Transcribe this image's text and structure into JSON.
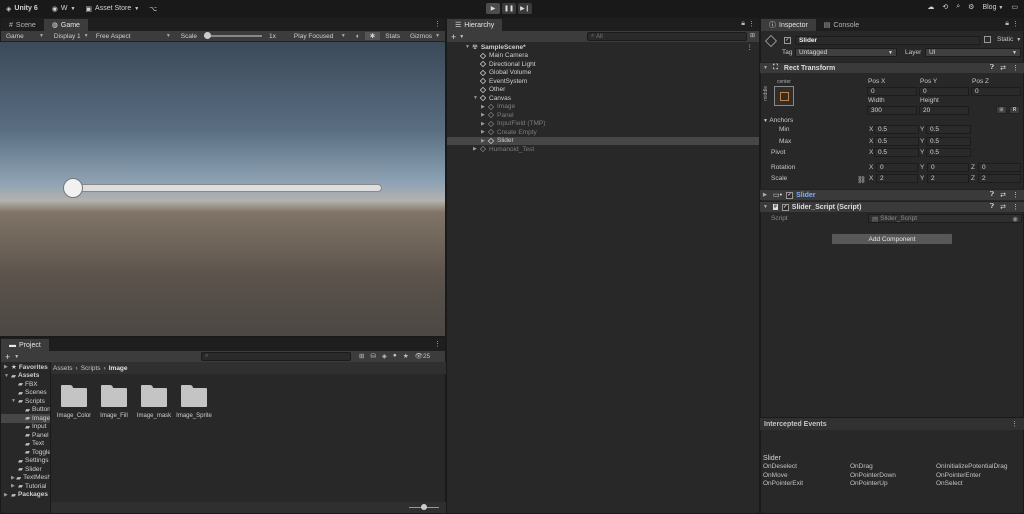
{
  "topbar": {
    "app": "Unity 6",
    "account": "W",
    "asset_store": "Asset Store",
    "blog": "Blog"
  },
  "scene_tabs": {
    "scene": "Scene",
    "game": "Game"
  },
  "game_toolbar": {
    "display_mode": "Game",
    "display": "Display 1",
    "aspect": "Free Aspect",
    "scale_label": "Scale",
    "scale_value": "1x",
    "play_mode": "Play Focused",
    "stats": "Stats",
    "gizmos": "Gizmos"
  },
  "hierarchy": {
    "tab": "Hierarchy",
    "search_placeholder": "All",
    "items": [
      {
        "label": "SampleScene*",
        "depth": 0,
        "expanded": true,
        "type": "scene",
        "dim": false,
        "selected": false
      },
      {
        "label": "Main Camera",
        "depth": 1,
        "dim": false
      },
      {
        "label": "Directional Light",
        "depth": 1,
        "dim": false
      },
      {
        "label": "Global Volume",
        "depth": 1,
        "dim": false
      },
      {
        "label": "EventSystem",
        "depth": 1,
        "dim": false
      },
      {
        "label": "Other",
        "depth": 1,
        "dim": false
      },
      {
        "label": "Canvas",
        "depth": 1,
        "expanded": true,
        "dim": false
      },
      {
        "label": "Image",
        "depth": 2,
        "collapsed": true,
        "dim": true
      },
      {
        "label": "Panel",
        "depth": 2,
        "collapsed": true,
        "dim": true
      },
      {
        "label": "InputField (TMP)",
        "depth": 2,
        "collapsed": true,
        "dim": true
      },
      {
        "label": "Create Empty",
        "depth": 2,
        "collapsed": true,
        "dim": true
      },
      {
        "label": "Slider",
        "depth": 2,
        "collapsed": true,
        "dim": false,
        "selected": true
      },
      {
        "label": "Humanoid_Test",
        "depth": 1,
        "collapsed": true,
        "dim": true
      }
    ]
  },
  "inspector": {
    "tabs": [
      "Inspector",
      "Console"
    ],
    "object_name": "Slider",
    "static_label": "Static",
    "tag_label": "Tag",
    "tag_value": "Untagged",
    "layer_label": "Layer",
    "layer_value": "UI",
    "rect_transform": {
      "title": "Rect Transform",
      "anchor_preset_top": "center",
      "anchor_preset_side": "middle",
      "pos_x_label": "Pos X",
      "pos_y_label": "Pos Y",
      "pos_z_label": "Pos Z",
      "pos_x": "0",
      "pos_y": "0",
      "pos_z": "0",
      "width_label": "Width",
      "height_label": "Height",
      "width": "300",
      "height": "20",
      "anchors_label": "Anchors",
      "min_label": "Min",
      "max_label": "Max",
      "pivot_label": "Pivot",
      "min_x": "0.5",
      "min_y": "0.5",
      "max_x": "0.5",
      "max_y": "0.5",
      "pivot_x": "0.5",
      "pivot_y": "0.5",
      "rotation_label": "Rotation",
      "scale_label": "Scale",
      "rot_x": "0",
      "rot_y": "0",
      "rot_z": "0",
      "scale_x": "2",
      "scale_y": "2",
      "scale_z": "2",
      "x": "X",
      "y": "Y",
      "z": "Z"
    },
    "slider_component": "Slider",
    "script_component": "Slider_Script (Script)",
    "script_label": "Script",
    "script_value": "Slider_Script",
    "add_component": "Add Component"
  },
  "intercepted_events": {
    "title": "Intercepted Events",
    "object": "Slider",
    "col1": [
      "OnDeselect",
      "OnMove",
      "OnPointerExit"
    ],
    "col2": [
      "OnDrag",
      "OnPointerDown",
      "OnPointerUp"
    ],
    "col3": [
      "OnInitializePotentialDrag",
      "OnPointerEnter",
      "OnSelect"
    ]
  },
  "project": {
    "tab": "Project",
    "hidden_count": "25",
    "breadcrumb": [
      "Assets",
      "Scripts",
      "Image"
    ],
    "tree": [
      {
        "label": "Favorites",
        "depth": 0,
        "bold": true
      },
      {
        "label": "Assets",
        "depth": 0,
        "bold": true
      },
      {
        "label": "FBX",
        "depth": 1
      },
      {
        "label": "Scenes",
        "depth": 1
      },
      {
        "label": "Scripts",
        "depth": 1
      },
      {
        "label": "Button",
        "depth": 2
      },
      {
        "label": "Image",
        "depth": 2
      },
      {
        "label": "Input",
        "depth": 2
      },
      {
        "label": "Panel",
        "depth": 2
      },
      {
        "label": "Text",
        "depth": 2
      },
      {
        "label": "Toggle",
        "depth": 2
      },
      {
        "label": "Settings",
        "depth": 1
      },
      {
        "label": "Slider",
        "depth": 1
      },
      {
        "label": "TextMesh",
        "depth": 1
      },
      {
        "label": "Tutorial",
        "depth": 1
      },
      {
        "label": "Packages",
        "depth": 0,
        "bold": true
      }
    ],
    "folders": [
      "Image_Color",
      "Image_Fill",
      "Image_mask",
      "Image_Sprite"
    ]
  },
  "colors": {
    "accent": "#4a7fc1",
    "selected_row": "#474747",
    "slider_label": "#7fb0ff"
  }
}
